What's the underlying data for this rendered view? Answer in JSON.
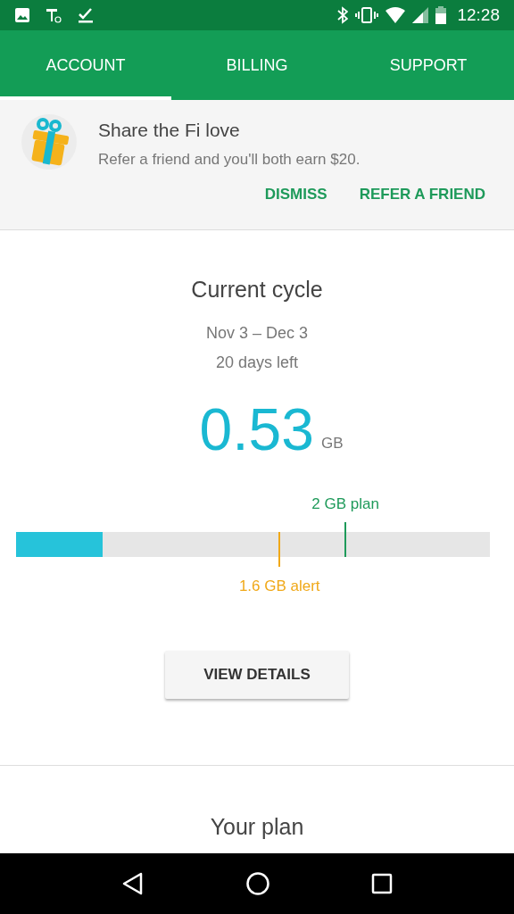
{
  "status_bar": {
    "time": "12:28"
  },
  "tabs": [
    {
      "label": "ACCOUNT",
      "selected": true
    },
    {
      "label": "BILLING",
      "selected": false
    },
    {
      "label": "SUPPORT",
      "selected": false
    }
  ],
  "promo": {
    "title": "Share the Fi love",
    "text": "Refer a friend and you'll both earn $20.",
    "actions": [
      "DISMISS",
      "REFER A FRIEND"
    ]
  },
  "cycle": {
    "title": "Current cycle",
    "dates": "Nov 3 – Dec 3",
    "remaining": "20 days left",
    "usage": "0.53",
    "unit": "GB",
    "level": 0.183,
    "markers": [
      {
        "kind": "plan",
        "label": "2 GB plan",
        "level": 0.695,
        "color": "#1e9a5a"
      },
      {
        "kind": "alert",
        "label": "1.6 GB alert",
        "level": 0.556,
        "color": "#f0a818"
      }
    ],
    "button": "VIEW DETAILS"
  },
  "plan": {
    "title": "Your plan"
  }
}
